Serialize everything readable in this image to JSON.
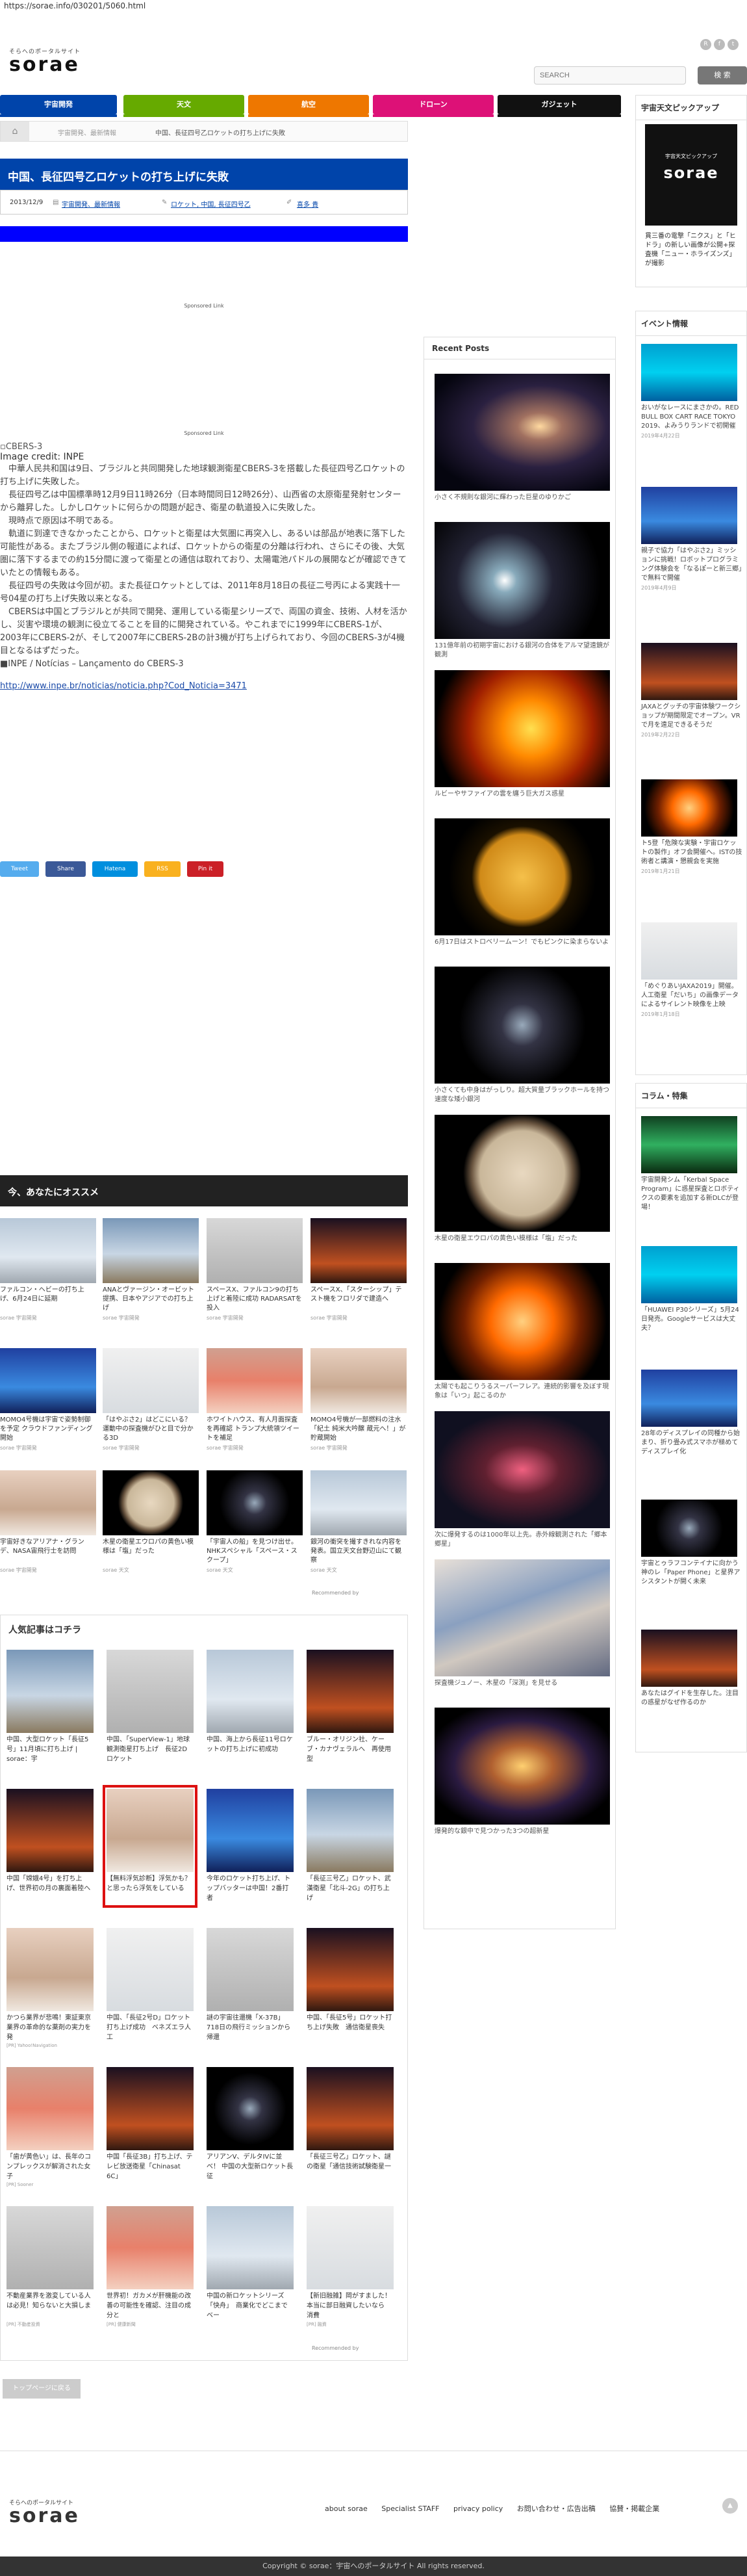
{
  "url": "https://sorae.info/030201/5060.html",
  "header": {
    "tagline": "そらへのポータルサイト",
    "logo": "sorae",
    "search_placeholder": "SEARCH",
    "search_button": "検 索",
    "social": [
      "rss-icon",
      "facebook-icon",
      "twitter-icon"
    ]
  },
  "nav": [
    {
      "label": "宇宙開発",
      "color": "#0044aa"
    },
    {
      "label": "天文",
      "color": "#66aa00"
    },
    {
      "label": "航空",
      "color": "#ee7700"
    },
    {
      "label": "ドローン",
      "color": "#dd1177"
    },
    {
      "label": "ガジェット",
      "color": "#111111"
    }
  ],
  "breadcrumb": [
    "宇宙開発、最新情報",
    "中国、長征四号乙ロケットの打ち上げに失敗"
  ],
  "article": {
    "title": "中国、長征四号乙ロケットの打ち上げに失敗",
    "date": "2013/12/9",
    "category": "宇宙開発、最新情報",
    "tags": "ロケット, 中国, 長征四号乙",
    "author": "喜多 貴",
    "sponsored": "Sponsored Link",
    "image_alt": "CBERS-3",
    "image_credit": "Image credit: INPE",
    "paragraphs": [
      "中華人民共和国は9日、ブラジルと共同開発した地球観測衛星CBERS-3を搭載した長征四号乙ロケットの打ち上げに失敗した。",
      "長征四号乙は中国標準時12月9日11時26分（日本時間同日12時26分）、山西省の太原衛星発射センターから離昇した。しかしロケットに何らかの問題が起き、衛星の軌道投入に失敗した。",
      "現時点で原因は不明である。",
      "軌道に到達できなかったことから、ロケットと衛星は大気圏に再突入し、あるいは部品が地表に落下した可能性がある。またブラジル側の報道によれば、ロケットからの衛星の分離は行われ、さらにその後、大気圏に落下するまでの約15分間に渡って衛星との通信は取れており、太陽電池パドルの展開などが確認できていたとの情報もある。",
      "長征四号の失敗は今回が初。また長征ロケットとしては、2011年8月18日の長征二号丙による実践十一号04星の打ち上げ失敗以来となる。",
      "CBERSは中国とブラジルとが共同で開発、運用している衛星シリーズで、両国の資金、技術、人材を活かし、災害や環境の観測に役立てることを目的に開発されている。やこれまでに1999年にCBERS-1が、2003年にCBERS-2が、そして2007年にCBERS-2Bの計3機が打ち上げられており、今回のCBERS-3が4機目となるはずだった。"
    ],
    "source_label": "■INPE / Notícias – Lançamento do CBERS-3",
    "source_link": "http://www.inpe.br/noticias/noticia.php?Cod_Noticia=3471"
  },
  "share": [
    {
      "label": "Tweet",
      "color": "#55acee"
    },
    {
      "label": "Share",
      "color": "#3b5998"
    },
    {
      "label": "Hatena",
      "color": "#008fde"
    },
    {
      "label": "RSS",
      "color": "#f9b11f"
    },
    {
      "label": "Pin it",
      "color": "#cb2027"
    }
  ],
  "recommend": {
    "heading": "今、あなたにオススメ",
    "items": [
      {
        "caption": "ファルコン・ヘビーの打ち上げ、6月24日に延期",
        "source": "sorae 宇宙開発"
      },
      {
        "caption": "ANAとヴァージン・オービット提携、日本やアジアでの打ち上げ",
        "source": "sorae 宇宙開発"
      },
      {
        "caption": "スペースX、ファルコン9の打ち上げと着陸に成功 RADARSATを投入",
        "source": "sorae 宇宙開発"
      },
      {
        "caption": "スペースX、「スターシップ」テスト機をフロリダで建造へ",
        "source": "sorae 宇宙開発"
      },
      {
        "caption": "MOMO4号機は宇宙で姿勢制御を予定 クラウドファンディング開始",
        "source": "sorae 宇宙開発"
      },
      {
        "caption": "「はやぶさ2」はどこにいる？ 運動中の探査機がひと目で分かる3D",
        "source": "sorae 宇宙開発"
      },
      {
        "caption": "ホワイトハウス、有人月面探査を再確認 トランプ大統領ツイートを補足",
        "source": "sorae 宇宙開発"
      },
      {
        "caption": "MOMO4号機が一部燃料の注水「紀土 純米大吟醸 蔵元へ！」が貯蔵開始",
        "source": "sorae 宇宙開発"
      },
      {
        "caption": "宇宙好きなアリアナ・グランデ、NASA宙飛行士を訪問",
        "source": "sorae 宇宙開発"
      },
      {
        "caption": "木星の衛星エウロパの黄色い模様は「塩」だった",
        "source": "sorae 天文"
      },
      {
        "caption": "「宇宙人の船」を見つけ出せ。NHKスペシャル「スペース・スクープ」",
        "source": "sorae 天文"
      },
      {
        "caption": "銀河の衝突を撮すきれな内容を発表。国立天文台野辺山にて観察",
        "source": "sorae 天文"
      }
    ],
    "provider": "Recommended by"
  },
  "popular": {
    "heading": "人気記事はコチラ",
    "items": [
      {
        "caption": "中国、大型ロケット「長征5号」11月頃に打ち上げ | sorae：宇",
        "source": ""
      },
      {
        "caption": "中国、「SuperView-1」地球観測衛星打ち上げ　長征2Dロケット",
        "source": ""
      },
      {
        "caption": "中国、海上から長征11号ロケットの打ち上げに初成功",
        "source": ""
      },
      {
        "caption": "ブルー・オリジン社、ケーブ・カナヴェラルへ　再使用型",
        "source": ""
      },
      {
        "caption": "中国「嫦娥4号」を打ち上げ、世界初の月の裏面着陸へ",
        "source": ""
      },
      {
        "caption": "【無料浮気診断】浮気かも？と思ったら浮気をしている",
        "source": "[PR]"
      },
      {
        "caption": "今年のロケット打ち上げ、トップバッターは中国！2番打者",
        "source": ""
      },
      {
        "caption": "「長征三号乙」ロケット、武漢衛星「北斗-2G」の打ち上げ",
        "source": ""
      },
      {
        "caption": "かつら業界が悲鳴！東証東京業界の革命的な薬剤の実力を発",
        "source": "[PR] Yahoo!Navigation"
      },
      {
        "caption": "中国、「長征2号D」ロケット打ち上げ成功　ベネズエラ人工",
        "source": ""
      },
      {
        "caption": "謎の宇宙往還機「X-37B」718日の飛行ミッションから帰還",
        "source": ""
      },
      {
        "caption": "中国、「長征5号」ロケット打ち上げ失敗　通信衛星喪失",
        "source": ""
      },
      {
        "caption": "「歯が黄色い」は、長年のコンプレックスが解消された女子",
        "source": "[PR] Sooner"
      },
      {
        "caption": "中国「長征3B」打ち上げ、テレビ放送衛星「Chinasat 6C」",
        "source": ""
      },
      {
        "caption": "アリアンV、デルタIVに並べ！ 中国の大型新ロケット長征",
        "source": ""
      },
      {
        "caption": "「長征三号乙」ロケット、謎の衛星「通信技術試験衛星一",
        "source": ""
      },
      {
        "caption": "不動産業界を激変している人は必見！知らないと大損しま",
        "source": "[PR] 不動産投資"
      },
      {
        "caption": "世界初！ガカメが肝機能の改善の可能性を確認、注目の成分と",
        "source": "[PR] 健康新聞"
      },
      {
        "caption": "中国の新ロケットシリーズ「快舟」　商業化でどこまでベー",
        "source": ""
      },
      {
        "caption": "【新旧融雑】岡がすました！本当に部日融資したいなら　消費",
        "source": "[PR] 融資"
      }
    ],
    "provider": "Recommended by"
  },
  "top_button": "トップページに戻る",
  "recent": {
    "heading": "Recent Posts",
    "items": [
      "小さく不規則な銀河に輝わった巨星のゆりかご",
      "131億年前の初期宇宙における銀河の合体をアルマ望遠鏡が観測",
      "ルビーやサファイアの雲を纏う巨大ガス惑星",
      "6月17日はストロベリームーン！でもピンクに染まらないよ",
      "小さくても中身はがっしり。超大質量ブラックホールを持つ速度な矮小銀河",
      "木星の衛星エウロパの黄色い模様は「塩」だった",
      "太陽でも起こりうるスーパーフレア。連続的影響を及ぼす現象は「いつ」起こるのか",
      "次に爆発するのは1000年以上先。赤外線観測された「郷本郷星」",
      "探査機ジュノー、木星の「深渕」を見せる",
      "爆発的な銀中で見つかった3つの超新星"
    ]
  },
  "sidebar": {
    "pickup_heading": "宇宙天文ピックアップ",
    "pickup_caption": "貫三番の電撃「ニクス」と「ヒドラ」の新しい画像が公開+探査機「ニュー・ホライズンズ」が撮影",
    "events_heading": "イベント情報",
    "events": [
      {
        "caption": "おいがなレースにまさかの。RED BULL BOX CART RACE TOKYO 2019、よみうりランドで初開催",
        "date": "2019年4月22日"
      },
      {
        "caption": "親子で協力「はやぶさ2」ミッションに挑戦！ロボットプログラミング体験会を「なるぽーと新三郷」で無料で開催",
        "date": "2019年4月9日"
      },
      {
        "caption": "JAXAとグッチの宇宙体験ワークショップが期間限定でオープン。VRで月を遠足できるそうだ",
        "date": "2019年2月22日"
      },
      {
        "caption": "ト5登「危険な実験・宇宙ロケットの製作」オフ会開催へ。ISTの技術者と講演・懇親会を実施",
        "date": "2019年1月21日"
      },
      {
        "caption": "「めぐりあいJAXA2019」開催。人工衛星「だいち」の画像データによるサイレント映像を上映",
        "date": "2019年1月18日"
      }
    ],
    "column_heading": "コラム・特集",
    "columns": [
      {
        "caption": "宇宙開発シム「Kerbal Space Program」に惑星探査とロボティクスの要素を追加する新DLCが登場！",
        "date": ""
      },
      {
        "caption": "「HUAWEI P30シリーズ」5月24日発売。Googleサービスは大丈夫？",
        "date": ""
      },
      {
        "caption": "28年のディスプレイの同種から始まり、折り畳み式スマホが極めてディスプレイ化",
        "date": ""
      },
      {
        "caption": "宇宙とゥラフコンテイナに向かう神のレ「Paper Phone」と星界アシスタントが開く未来",
        "date": ""
      },
      {
        "caption": "あなたはグイドを生存した。注目の惑星がなぜ作るのか",
        "date": ""
      }
    ]
  },
  "footer": {
    "tagline": "そらへのポータルサイト",
    "logo": "sorae",
    "links": [
      "about sorae",
      "Specialist STAFF",
      "privacy policy",
      "お問い合わせ・広告出稿",
      "協賛・掲載企業"
    ],
    "copyright": "Copyright © sorae：宇宙へのポータルサイト All rights reserved."
  }
}
